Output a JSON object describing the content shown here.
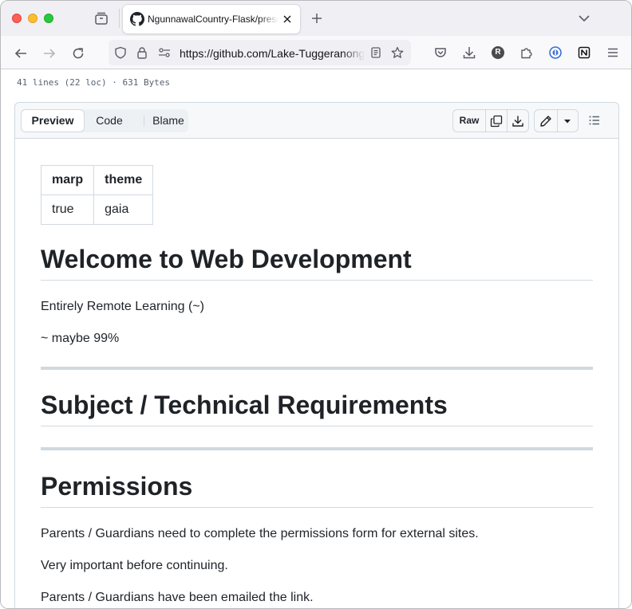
{
  "browser": {
    "tab_title": "NgunnawalCountry-Flask/presentation",
    "url": "https://github.com/Lake-Tuggeranong/NgunnawalCountry-Flask",
    "profile_initial": "R"
  },
  "file": {
    "info": "41 lines (22 loc) · 631 Bytes"
  },
  "toolbar": {
    "tabs": [
      "Preview",
      "Code",
      "Blame"
    ],
    "active_tab": "Preview",
    "raw_label": "Raw"
  },
  "front_matter": {
    "headers": [
      "marp",
      "theme"
    ],
    "values": [
      "true",
      "gaia"
    ]
  },
  "sections": {
    "welcome": {
      "heading": "Welcome to Web Development",
      "p1": "Entirely Remote Learning (~)",
      "p2": "~ maybe 99%"
    },
    "subject": {
      "heading": "Subject / Technical Requirements"
    },
    "permissions": {
      "heading": "Permissions",
      "p1": "Parents / Guardians need to complete the permissions form for external sites.",
      "p2": "Very important before continuing.",
      "p3": "Parents / Guardians have been emailed the link."
    }
  },
  "colors": {
    "text": "#1f2328",
    "border": "#d1d9e0",
    "muted": "#59636e"
  }
}
